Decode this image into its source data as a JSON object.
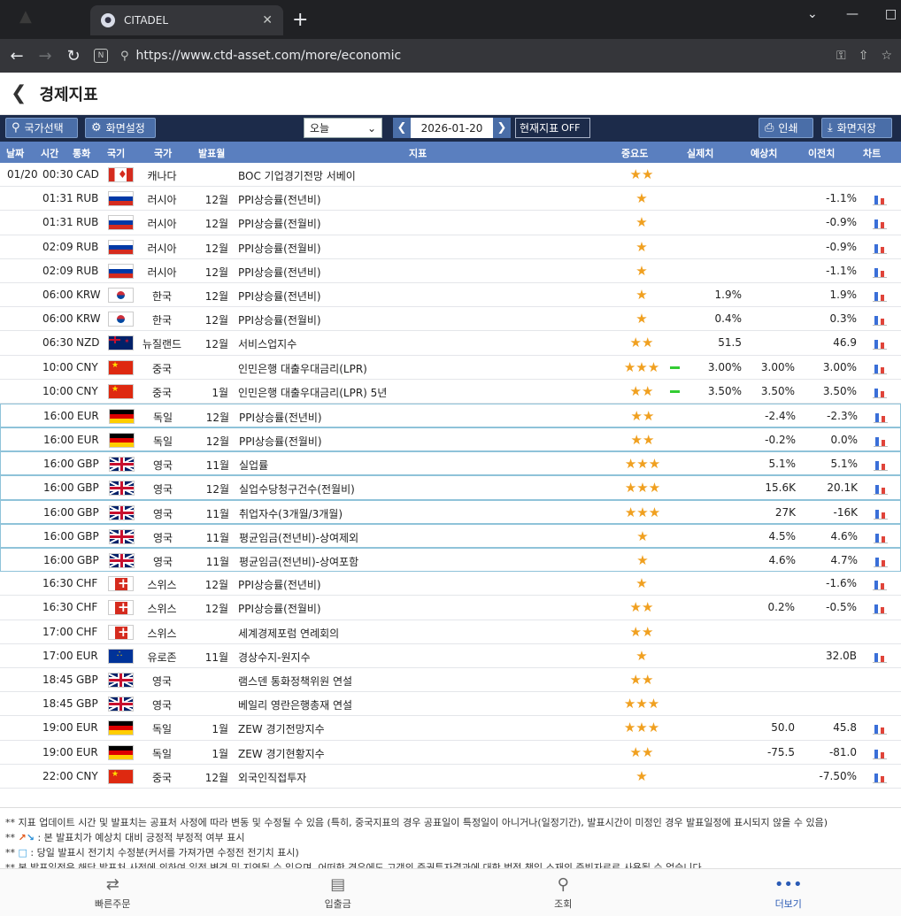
{
  "browser": {
    "tab_title": "CITADEL",
    "url": "https://www.ctd-asset.com/more/economic"
  },
  "page": {
    "title": "경제지표"
  },
  "toolbar": {
    "country_select": "국가선택",
    "screen_settings": "화면설정",
    "period": "오늘",
    "date": "2026-01-20",
    "current_indicator": "현재지표",
    "current_state": "OFF",
    "print": "인쇄",
    "save_screen": "화면저장"
  },
  "table": {
    "headers": {
      "date": "날짜",
      "time": "시간",
      "currency": "통화",
      "flag": "국기",
      "country": "국가",
      "month": "발표월",
      "indicator": "지표",
      "importance": "중요도",
      "actual": "실제치",
      "forecast": "예상치",
      "previous": "이전치",
      "chart": "차트"
    },
    "rows": [
      {
        "date": "01/20",
        "time": "00:30",
        "cur": "CAD",
        "flag": "ca",
        "country": "캐나다",
        "month": "",
        "ind": "BOC 기업경기전망 서베이",
        "stars": "★★",
        "mark": false,
        "actual": "",
        "fc": "",
        "prev": "",
        "chart": false,
        "hl": false
      },
      {
        "date": "",
        "time": "01:31",
        "cur": "RUB",
        "flag": "ru",
        "country": "러시아",
        "month": "12월",
        "ind": "PPI상승률(전년비)",
        "stars": "★",
        "mark": false,
        "actual": "",
        "fc": "",
        "prev": "-1.1%",
        "chart": true,
        "hl": false
      },
      {
        "date": "",
        "time": "01:31",
        "cur": "RUB",
        "flag": "ru",
        "country": "러시아",
        "month": "12월",
        "ind": "PPI상승률(전월비)",
        "stars": "★",
        "mark": false,
        "actual": "",
        "fc": "",
        "prev": "-0.9%",
        "chart": true,
        "hl": false
      },
      {
        "date": "",
        "time": "02:09",
        "cur": "RUB",
        "flag": "ru",
        "country": "러시아",
        "month": "12월",
        "ind": "PPI상승률(전월비)",
        "stars": "★",
        "mark": false,
        "actual": "",
        "fc": "",
        "prev": "-0.9%",
        "chart": true,
        "hl": false
      },
      {
        "date": "",
        "time": "02:09",
        "cur": "RUB",
        "flag": "ru",
        "country": "러시아",
        "month": "12월",
        "ind": "PPI상승률(전년비)",
        "stars": "★",
        "mark": false,
        "actual": "",
        "fc": "",
        "prev": "-1.1%",
        "chart": true,
        "hl": false
      },
      {
        "date": "",
        "time": "06:00",
        "cur": "KRW",
        "flag": "kr",
        "country": "한국",
        "month": "12월",
        "ind": "PPI상승률(전년비)",
        "stars": "★",
        "mark": false,
        "actual": "1.9%",
        "fc": "",
        "prev": "1.9%",
        "chart": true,
        "hl": false
      },
      {
        "date": "",
        "time": "06:00",
        "cur": "KRW",
        "flag": "kr",
        "country": "한국",
        "month": "12월",
        "ind": "PPI상승률(전월비)",
        "stars": "★",
        "mark": false,
        "actual": "0.4%",
        "fc": "",
        "prev": "0.3%",
        "chart": true,
        "hl": false
      },
      {
        "date": "",
        "time": "06:30",
        "cur": "NZD",
        "flag": "nz",
        "country": "뉴질랜드",
        "month": "12월",
        "ind": "서비스업지수",
        "stars": "★★",
        "mark": false,
        "actual": "51.5",
        "fc": "",
        "prev": "46.9",
        "chart": true,
        "hl": false
      },
      {
        "date": "",
        "time": "10:00",
        "cur": "CNY",
        "flag": "cn",
        "country": "중국",
        "month": "",
        "ind": "인민은행 대출우대금리(LPR)",
        "stars": "★★★",
        "mark": true,
        "actual": "3.00%",
        "fc": "3.00%",
        "prev": "3.00%",
        "chart": true,
        "hl": false
      },
      {
        "date": "",
        "time": "10:00",
        "cur": "CNY",
        "flag": "cn",
        "country": "중국",
        "month": "1월",
        "ind": "인민은행 대출우대금리(LPR) 5년",
        "stars": "★★",
        "mark": true,
        "actual": "3.50%",
        "fc": "3.50%",
        "prev": "3.50%",
        "chart": true,
        "hl": false
      },
      {
        "date": "",
        "time": "16:00",
        "cur": "EUR",
        "flag": "de",
        "country": "독일",
        "month": "12월",
        "ind": "PPI상승률(전년비)",
        "stars": "★★",
        "mark": false,
        "actual": "",
        "fc": "-2.4%",
        "prev": "-2.3%",
        "chart": true,
        "hl": true
      },
      {
        "date": "",
        "time": "16:00",
        "cur": "EUR",
        "flag": "de",
        "country": "독일",
        "month": "12월",
        "ind": "PPI상승률(전월비)",
        "stars": "★★",
        "mark": false,
        "actual": "",
        "fc": "-0.2%",
        "prev": "0.0%",
        "chart": true,
        "hl": true
      },
      {
        "date": "",
        "time": "16:00",
        "cur": "GBP",
        "flag": "gb",
        "country": "영국",
        "month": "11월",
        "ind": "실업률",
        "stars": "★★★",
        "mark": false,
        "actual": "",
        "fc": "5.1%",
        "prev": "5.1%",
        "chart": true,
        "hl": true
      },
      {
        "date": "",
        "time": "16:00",
        "cur": "GBP",
        "flag": "gb",
        "country": "영국",
        "month": "12월",
        "ind": "실업수당청구건수(전월비)",
        "stars": "★★★",
        "mark": false,
        "actual": "",
        "fc": "15.6K",
        "prev": "20.1K",
        "chart": true,
        "hl": true
      },
      {
        "date": "",
        "time": "16:00",
        "cur": "GBP",
        "flag": "gb",
        "country": "영국",
        "month": "11월",
        "ind": "취업자수(3개월/3개월)",
        "stars": "★★★",
        "mark": false,
        "actual": "",
        "fc": "27K",
        "prev": "-16K",
        "chart": true,
        "hl": true
      },
      {
        "date": "",
        "time": "16:00",
        "cur": "GBP",
        "flag": "gb",
        "country": "영국",
        "month": "11월",
        "ind": "평균임금(전년비)-상여제외",
        "stars": "★",
        "mark": false,
        "actual": "",
        "fc": "4.5%",
        "prev": "4.6%",
        "chart": true,
        "hl": true
      },
      {
        "date": "",
        "time": "16:00",
        "cur": "GBP",
        "flag": "gb",
        "country": "영국",
        "month": "11월",
        "ind": "평균임금(전년비)-상여포함",
        "stars": "★",
        "mark": false,
        "actual": "",
        "fc": "4.6%",
        "prev": "4.7%",
        "chart": true,
        "hl": true
      },
      {
        "date": "",
        "time": "16:30",
        "cur": "CHF",
        "flag": "ch",
        "country": "스위스",
        "month": "12월",
        "ind": "PPI상승률(전년비)",
        "stars": "★",
        "mark": false,
        "actual": "",
        "fc": "",
        "prev": "-1.6%",
        "chart": true,
        "hl": false
      },
      {
        "date": "",
        "time": "16:30",
        "cur": "CHF",
        "flag": "ch",
        "country": "스위스",
        "month": "12월",
        "ind": "PPI상승률(전월비)",
        "stars": "★★",
        "mark": false,
        "actual": "",
        "fc": "0.2%",
        "prev": "-0.5%",
        "chart": true,
        "hl": false
      },
      {
        "date": "",
        "time": "17:00",
        "cur": "CHF",
        "flag": "ch",
        "country": "스위스",
        "month": "",
        "ind": "세계경제포럼 연례회의",
        "stars": "★★",
        "mark": false,
        "actual": "",
        "fc": "",
        "prev": "",
        "chart": false,
        "hl": false
      },
      {
        "date": "",
        "time": "17:00",
        "cur": "EUR",
        "flag": "eu",
        "country": "유로존",
        "month": "11월",
        "ind": "경상수지-원지수",
        "stars": "★",
        "mark": false,
        "actual": "",
        "fc": "",
        "prev": "32.0B",
        "chart": true,
        "hl": false
      },
      {
        "date": "",
        "time": "18:45",
        "cur": "GBP",
        "flag": "gb",
        "country": "영국",
        "month": "",
        "ind": "램스덴 통화정책위원 연설",
        "stars": "★★",
        "mark": false,
        "actual": "",
        "fc": "",
        "prev": "",
        "chart": false,
        "hl": false
      },
      {
        "date": "",
        "time": "18:45",
        "cur": "GBP",
        "flag": "gb",
        "country": "영국",
        "month": "",
        "ind": "베일리 영란은행총재 연설",
        "stars": "★★★",
        "mark": false,
        "actual": "",
        "fc": "",
        "prev": "",
        "chart": false,
        "hl": false
      },
      {
        "date": "",
        "time": "19:00",
        "cur": "EUR",
        "flag": "de",
        "country": "독일",
        "month": "1월",
        "ind": "ZEW 경기전망지수",
        "stars": "★★★",
        "mark": false,
        "actual": "",
        "fc": "50.0",
        "prev": "45.8",
        "chart": true,
        "hl": false
      },
      {
        "date": "",
        "time": "19:00",
        "cur": "EUR",
        "flag": "de",
        "country": "독일",
        "month": "1월",
        "ind": "ZEW 경기현황지수",
        "stars": "★★",
        "mark": false,
        "actual": "",
        "fc": "-75.5",
        "prev": "-81.0",
        "chart": true,
        "hl": false
      },
      {
        "date": "",
        "time": "22:00",
        "cur": "CNY",
        "flag": "cn",
        "country": "중국",
        "month": "12월",
        "ind": "외국인직접투자",
        "stars": "★",
        "mark": false,
        "actual": "",
        "fc": "",
        "prev": "-7.50%",
        "chart": true,
        "hl": false
      }
    ]
  },
  "notes": {
    "n1": "** 지표 업데이트 시간 및 발표치는 공표처 사정에 따라 변동 및 수정될 수 있음 (특히, 중국지표의 경우 공표일이 특정일이 아니거나(일정기간), 발표시간이 미정인 경우 발표일정에 표시되지 않을 수 있음)",
    "n2": ": 본 발표치가 예상치 대비 긍정적 부정적 여부 표시",
    "n3": ": 당일 발표시 전기치 수정분(커서를 가져가면 수정전 전기치 표시)",
    "n4": "** 본 발표일정은 해당 발표처 사정에 의하여 일정 변경 및 지연될 수 있으며, 어떠한 경우에도 고객의 증권투자결과에 대한 법적 책임 소재의 증빙자료로 사용될 수 없습니다."
  },
  "bottom_nav": {
    "quick_order": "빠른주문",
    "deposit": "입출금",
    "inquiry": "조회",
    "more": "더보기"
  }
}
